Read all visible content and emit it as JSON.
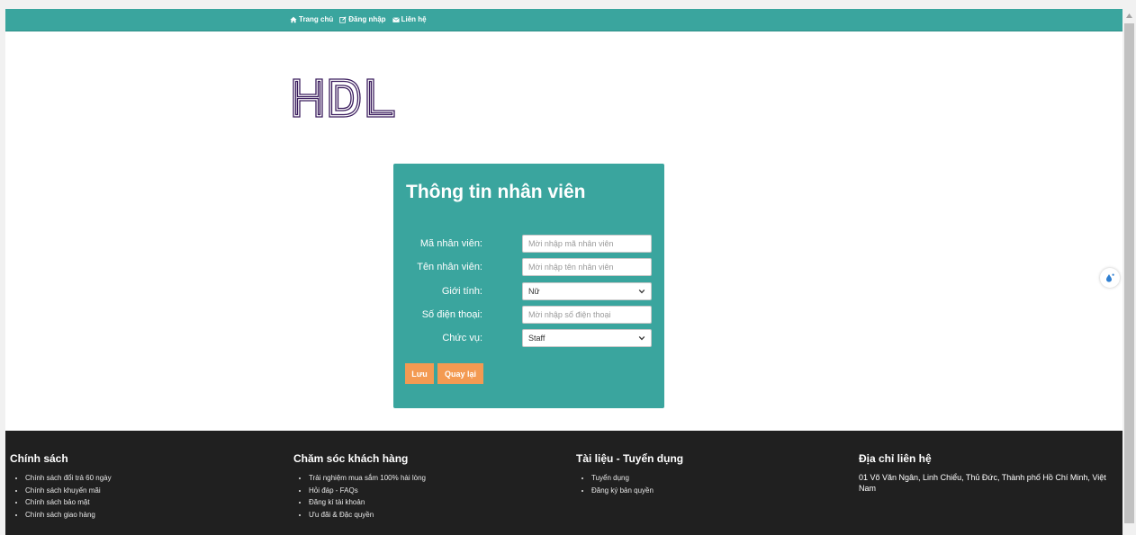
{
  "nav": {
    "items": [
      {
        "label": "Trang chủ",
        "icon": "home-icon"
      },
      {
        "label": "Đăng nhập",
        "icon": "edit-icon"
      },
      {
        "label": "Liên hệ",
        "icon": "envelope-icon"
      }
    ]
  },
  "logo": {
    "text": "HDL"
  },
  "form": {
    "title": "Thông tin nhân viên",
    "fields": {
      "employee_id": {
        "label": "Mã nhân viên:",
        "placeholder": "Mời nhập mã nhân viên",
        "value": ""
      },
      "employee_name": {
        "label": "Tên nhân viên:",
        "placeholder": "Mời nhập tên nhân viên",
        "value": ""
      },
      "gender": {
        "label": "Giới tính:",
        "selected": "Nữ"
      },
      "phone": {
        "label": "Số điện thoại:",
        "placeholder": "Mời nhập số điện thoại",
        "value": ""
      },
      "position": {
        "label": "Chức vụ:",
        "selected": "Staff"
      }
    },
    "buttons": {
      "save": "Lưu",
      "back": "Quay lại"
    }
  },
  "footer": {
    "policy": {
      "title": "Chính sách",
      "items": [
        "Chính sách đổi trả 60 ngày",
        "Chính sách khuyến mãi",
        "Chính sách bảo mật",
        "Chính sách giao hàng"
      ]
    },
    "care": {
      "title": "Chăm sóc khách hàng",
      "items": [
        "Trải nghiệm mua sắm 100% hài lòng",
        "Hỏi đáp - FAQs",
        "Đăng kí tài khoản",
        "Ưu đãi & Đặc quyền"
      ]
    },
    "docs": {
      "title": "Tài liệu - Tuyển dụng",
      "items": [
        "Tuyển dụng",
        "Đăng ký bản quyền"
      ]
    },
    "address": {
      "title": "Địa chỉ liên hệ",
      "text": "01 Võ Văn Ngân, Linh Chiểu, Thủ Đức, Thành phố Hồ Chí Minh, Việt Nam"
    }
  },
  "colors": {
    "teal": "#3aa59e",
    "orange": "#f39a52",
    "footer_bg": "#202020",
    "logo": "#3b1d5e"
  }
}
